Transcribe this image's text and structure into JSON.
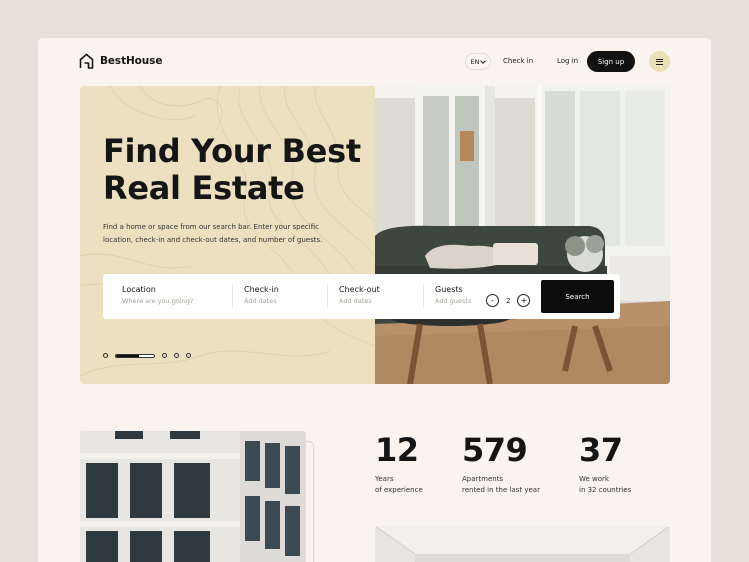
{
  "brand": {
    "name": "BestHouse",
    "icon": "house-icon"
  },
  "header": {
    "language": "EN",
    "check_in_link": "Check in",
    "login": "Log in",
    "signup": "Sign up",
    "menu_icon": "hamburger-icon"
  },
  "hero": {
    "title_line1": "Find Your Best",
    "title_line2": "Real Estate",
    "description": "Find a home or space from our search bar. Enter your specific location, check-in and check-out dates, and number of guests.",
    "slider_progress": 0.6
  },
  "search": {
    "location_label": "Location",
    "location_placeholder": "Where are you going?",
    "checkin_label": "Check-in",
    "checkin_placeholder": "Add dates",
    "checkout_label": "Check-out",
    "checkout_placeholder": "Add dates",
    "guests_label": "Guests",
    "guests_placeholder": "Add guests",
    "guests_value": "2",
    "minus": "-",
    "plus": "+",
    "button": "Search"
  },
  "stats": [
    {
      "number": "12",
      "line1": "Years",
      "line2": "of experience"
    },
    {
      "number": "579",
      "line1": "Apartments",
      "line2": "rented in the last year"
    },
    {
      "number": "37",
      "line1": "We work",
      "line2": "in 32 countries"
    }
  ],
  "colors": {
    "page_bg": "#e6e1d8",
    "card_bg": "#f9f4ef",
    "hero_bg": "#ece0c0",
    "accent": "#ebdfb7",
    "dark": "#111111"
  }
}
